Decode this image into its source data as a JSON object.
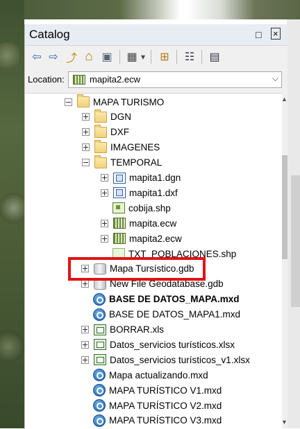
{
  "window": {
    "title": "Catalog",
    "controls": [
      "□",
      "×"
    ]
  },
  "toolbar": {
    "buttons": [
      {
        "name": "back-icon",
        "glyph": "⇦"
      },
      {
        "name": "forward-icon",
        "glyph": "⇨"
      },
      {
        "name": "up-one-level-icon",
        "glyph": "⤴"
      },
      {
        "name": "home-folder-icon",
        "glyph": "⌂"
      },
      {
        "name": "connect-folder-icon",
        "glyph": "▣"
      },
      {
        "name": "views-icon",
        "glyph": "▦"
      },
      {
        "name": "views-dropdown-icon",
        "glyph": "▾"
      },
      {
        "name": "connect-database-icon",
        "glyph": "⊞"
      },
      {
        "name": "toggle-contents-icon",
        "glyph": "☷"
      },
      {
        "name": "options-icon",
        "glyph": "▤"
      }
    ]
  },
  "location": {
    "label": "Location:",
    "value": "mapita2.ecw"
  },
  "tree": {
    "items": [
      {
        "label": "MAPA TURISMO",
        "icon": "folder",
        "expander": "minus",
        "indent": 0
      },
      {
        "label": "DGN",
        "icon": "folder",
        "expander": "plus",
        "indent": 1
      },
      {
        "label": "DXF",
        "icon": "folder",
        "expander": "plus",
        "indent": 1
      },
      {
        "label": "IMAGENES",
        "icon": "folder",
        "expander": "plus",
        "indent": 1
      },
      {
        "label": "TEMPORAL",
        "icon": "folder",
        "expander": "minus",
        "indent": 1
      },
      {
        "label": "mapita1.dgn",
        "icon": "cad",
        "expander": "plus",
        "indent": 2
      },
      {
        "label": "mapita1.dxf",
        "icon": "cad",
        "expander": "plus",
        "indent": 2
      },
      {
        "label": "cobija.shp",
        "icon": "shapefile",
        "expander": "none",
        "indent": 2
      },
      {
        "label": "mapita.ecw",
        "icon": "raster",
        "expander": "plus",
        "indent": 2
      },
      {
        "label": "mapita2.ecw",
        "icon": "raster",
        "expander": "plus",
        "indent": 2
      },
      {
        "label": "TXT_POBLACIONES.shp",
        "icon": "point-shapefile",
        "expander": "none",
        "indent": 2
      },
      {
        "label": "Mapa Tursístico.gdb",
        "icon": "geodatabase",
        "expander": "plus",
        "indent": 0,
        "highlighted": true
      },
      {
        "label": "New File Geodatabase.gdb",
        "icon": "geodatabase",
        "expander": "plus",
        "indent": 0
      },
      {
        "label": "BASE DE DATOS_MAPA.mxd",
        "icon": "mxd",
        "expander": "none",
        "indent": 0,
        "bold": true
      },
      {
        "label": "BASE DE DATOS_MAPA1.mxd",
        "icon": "mxd",
        "expander": "none",
        "indent": 0
      },
      {
        "label": "BORRAR.xls",
        "icon": "xls",
        "expander": "plus",
        "indent": 0
      },
      {
        "label": "Datos_servicios turísticos.xlsx",
        "icon": "xls",
        "expander": "plus",
        "indent": 0
      },
      {
        "label": "Datos_servicios turísticos_v1.xlsx",
        "icon": "xls",
        "expander": "plus",
        "indent": 0
      },
      {
        "label": "Mapa actualizando.mxd",
        "icon": "mxd",
        "expander": "none",
        "indent": 0
      },
      {
        "label": "MAPA TURÍSTICO V1.mxd",
        "icon": "mxd",
        "expander": "none",
        "indent": 0
      },
      {
        "label": "MAPA TURÍSTICO V2.mxd",
        "icon": "mxd",
        "expander": "none",
        "indent": 0
      },
      {
        "label": "MAPA TURÍSTICO V3.mxd",
        "icon": "mxd",
        "expander": "none",
        "indent": 0
      }
    ]
  },
  "colors": {
    "highlight": "#e31212",
    "titlebar": "#e8edf3"
  }
}
